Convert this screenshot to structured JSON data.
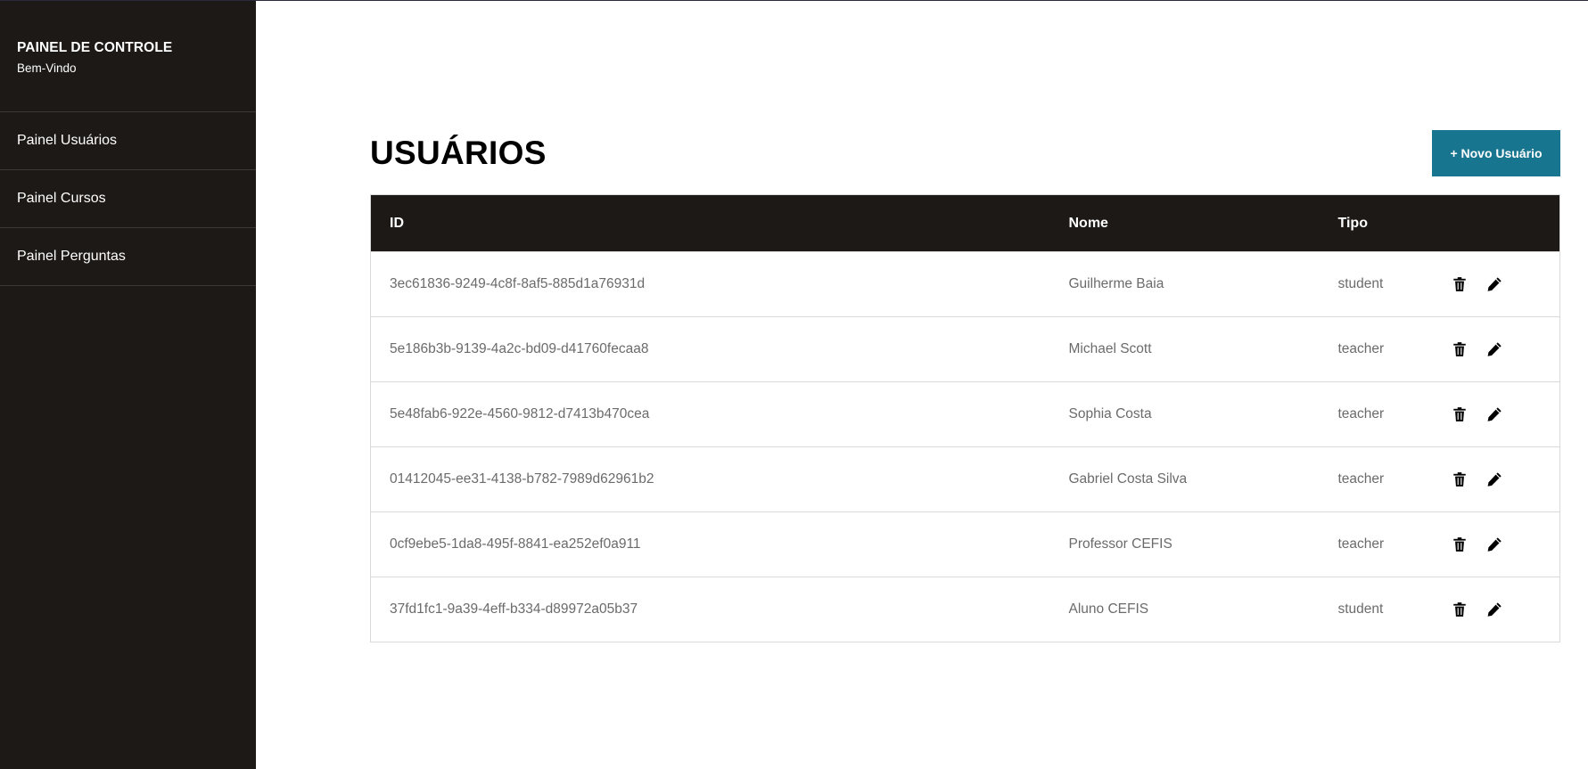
{
  "sidebar": {
    "title": "PAINEL DE CONTROLE",
    "subtitle": "Bem-Vindo",
    "items": [
      {
        "label": "Painel Usuários"
      },
      {
        "label": "Painel Cursos"
      },
      {
        "label": "Painel Perguntas"
      }
    ]
  },
  "page": {
    "title": "USUÁRIOS",
    "new_button_label": "+ Novo Usuário"
  },
  "table": {
    "headers": {
      "id": "ID",
      "nome": "Nome",
      "tipo": "Tipo"
    },
    "rows": [
      {
        "id": "3ec61836-9249-4c8f-8af5-885d1a76931d",
        "nome": "Guilherme Baia",
        "tipo": "student"
      },
      {
        "id": "5e186b3b-9139-4a2c-bd09-d41760fecaa8",
        "nome": "Michael Scott",
        "tipo": "teacher"
      },
      {
        "id": "5e48fab6-922e-4560-9812-d7413b470cea",
        "nome": "Sophia Costa",
        "tipo": "teacher"
      },
      {
        "id": "01412045-ee31-4138-b782-7989d62961b2",
        "nome": "Gabriel Costa Silva",
        "tipo": "teacher"
      },
      {
        "id": "0cf9ebe5-1da8-495f-8841-ea252ef0a911",
        "nome": "Professor CEFIS",
        "tipo": "teacher"
      },
      {
        "id": "37fd1fc1-9a39-4eff-b334-d89972a05b37",
        "nome": "Aluno CEFIS",
        "tipo": "student"
      }
    ],
    "row_actions": [
      "trash-icon",
      "pencil-icon"
    ]
  },
  "colors": {
    "sidebar_bg": "#1d1916",
    "header_bg": "#1d1916",
    "accent": "#187590",
    "cell_text": "#6b6b6b"
  }
}
